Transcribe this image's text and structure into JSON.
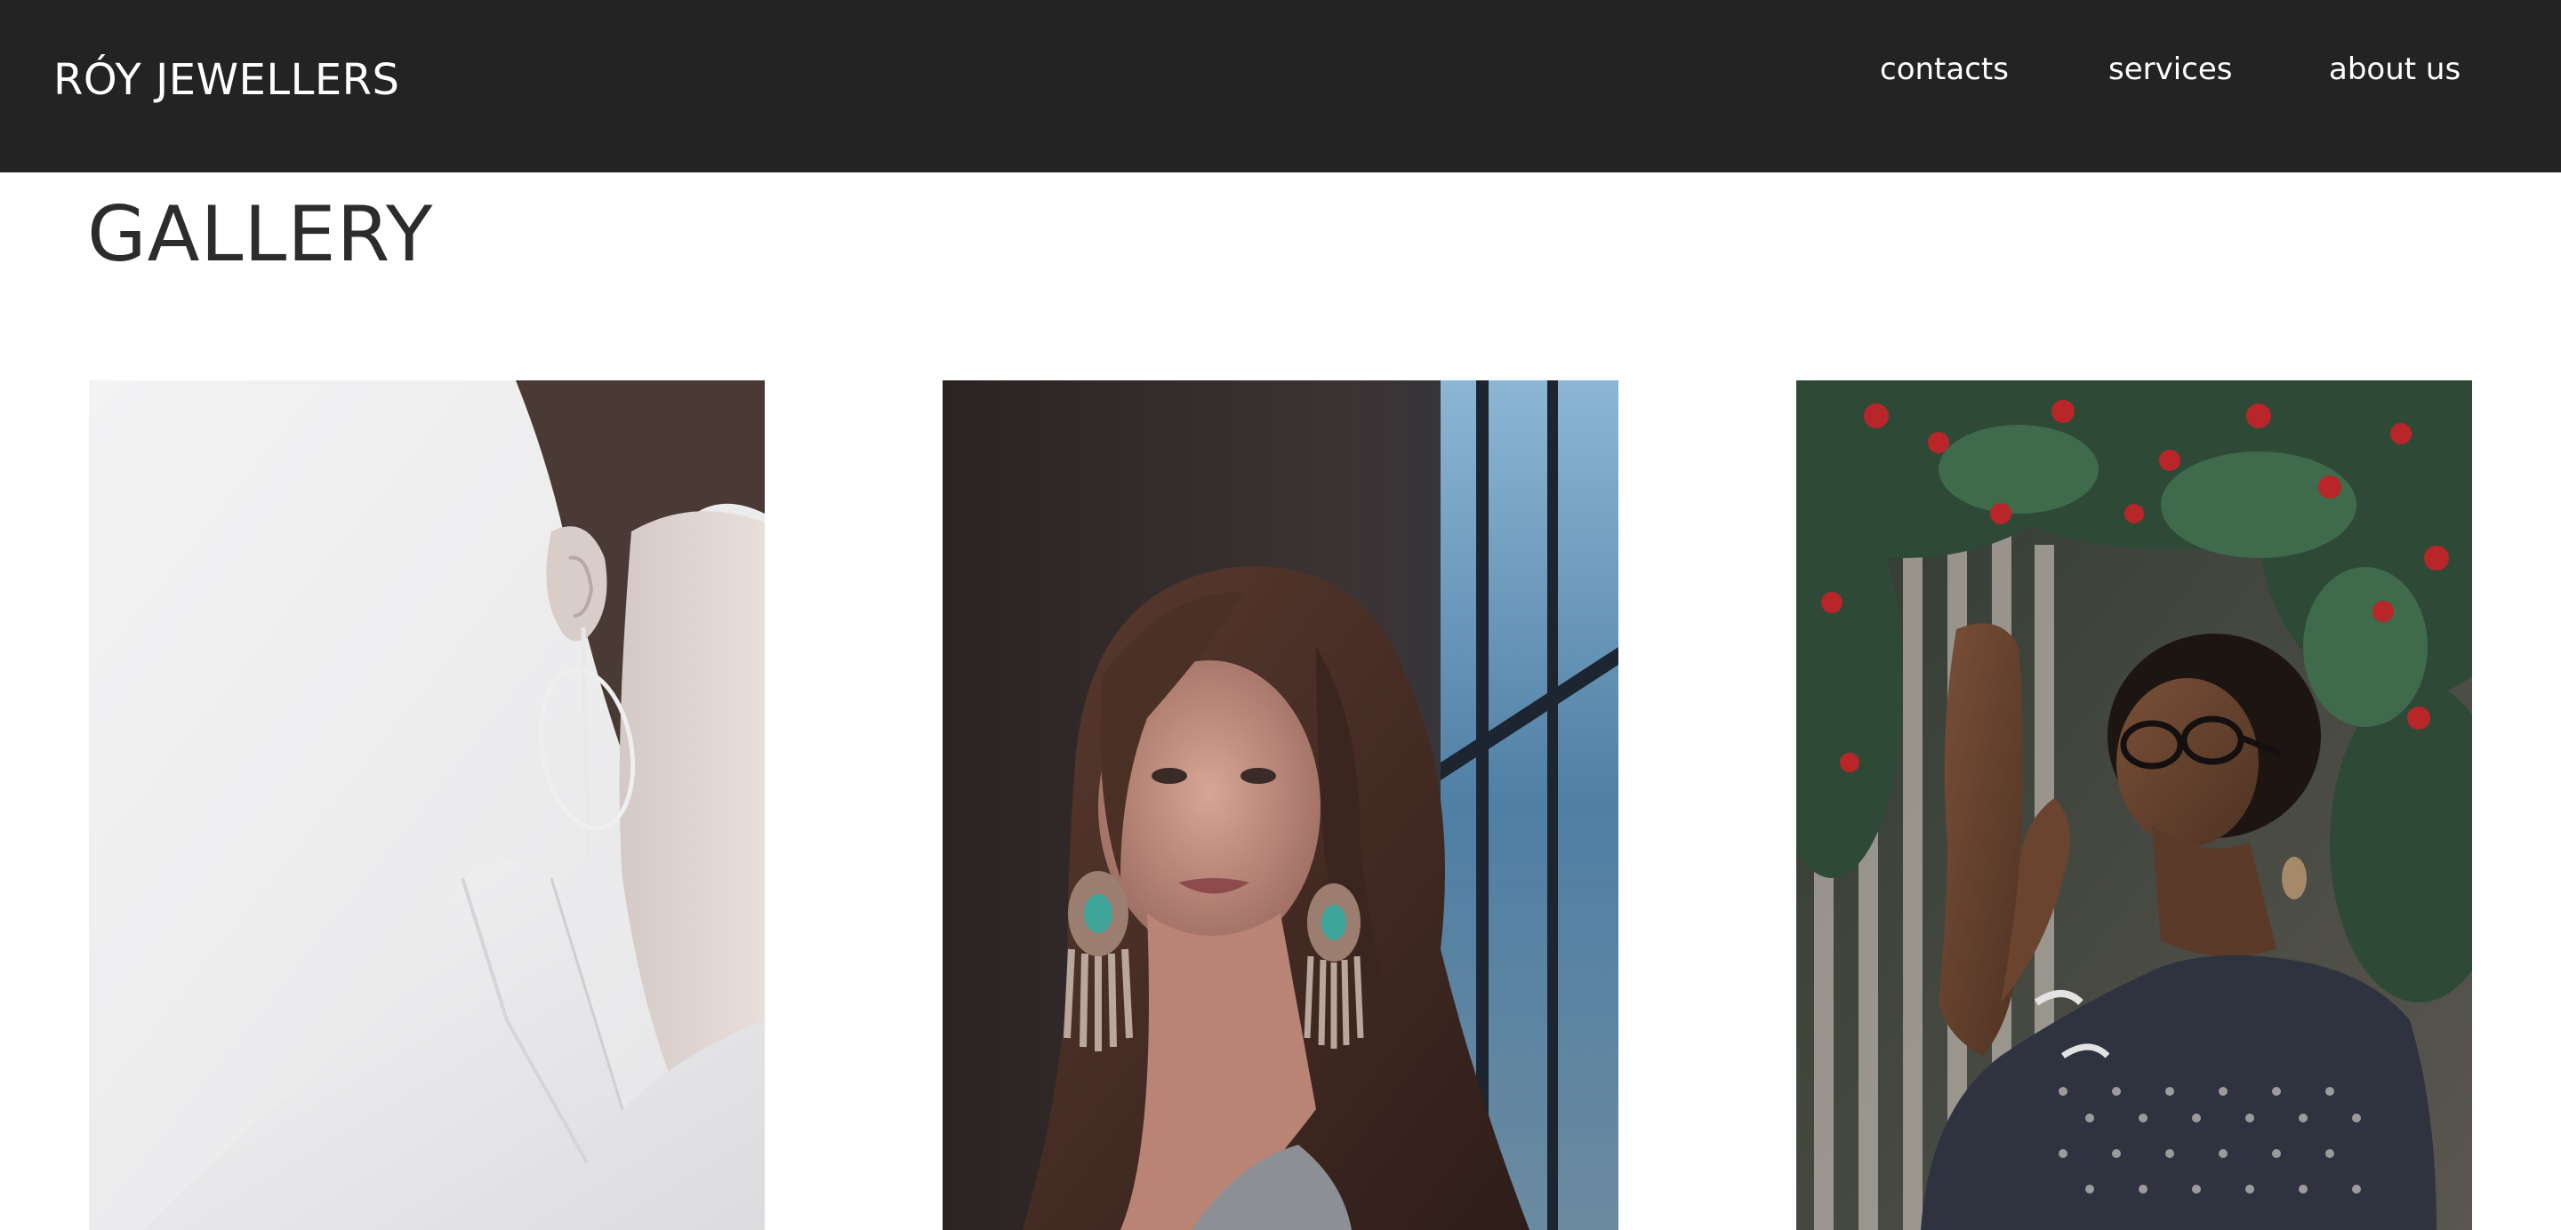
{
  "header": {
    "brand": "RÓY JEWELLERS",
    "nav": {
      "contacts": "contacts",
      "services": "services",
      "about": "about us"
    },
    "background_color": "#232323",
    "text_color": "#ffffff"
  },
  "main": {
    "title": "GALLERY",
    "gallery": [
      {
        "subject": "model with large silver hoop earring, white shirt"
      },
      {
        "subject": "woman with long wavy hair and turquoise feather earrings by a window"
      },
      {
        "subject": "woman in glasses and patterned blouse under red flowering tree"
      }
    ]
  }
}
